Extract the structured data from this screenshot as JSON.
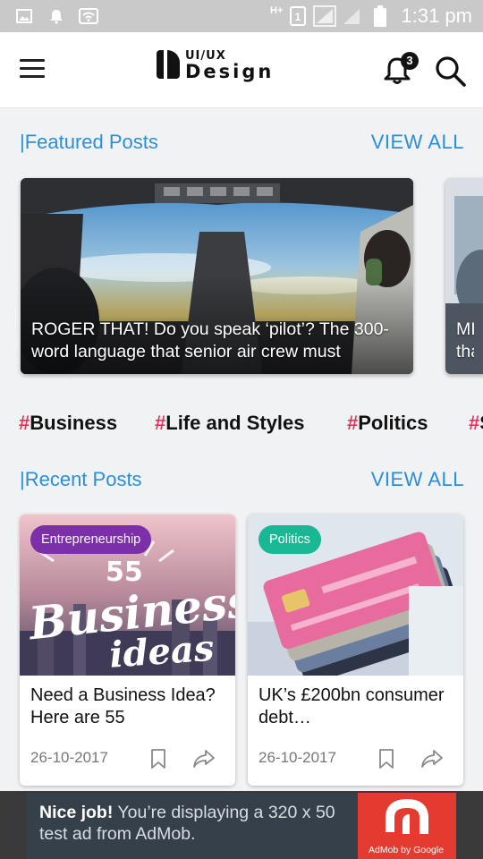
{
  "status_bar": {
    "time": "1:31 pm",
    "network": "H+"
  },
  "app_bar": {
    "logo_line1": "UI/UX",
    "logo_line2": "Design",
    "notification_count": "3"
  },
  "featured": {
    "title": "|Featured Posts",
    "view_all": "VIEW ALL",
    "cards": [
      {
        "caption": "ROGER THAT! Do you speak ‘pilot’? The 300-word language that senior air crew must"
      },
      {
        "caption": "MIL tha"
      }
    ]
  },
  "tags": [
    {
      "hash": "#",
      "label": "Business"
    },
    {
      "hash": "#",
      "label": "Life and Styles"
    },
    {
      "hash": "#",
      "label": "Politics"
    },
    {
      "hash": "#",
      "label": "S"
    }
  ],
  "recent": {
    "title": "|Recent Posts",
    "view_all": "VIEW ALL",
    "posts": [
      {
        "category": "Entrepreneurship",
        "category_color": "#7b2fa8",
        "image_text_top": "55",
        "image_text_main": "Business",
        "image_text_sub": "ideas",
        "title": "Need a Business Idea? Here are 55",
        "date": "26-10-2017"
      },
      {
        "category": "Politics",
        "category_color": "#19b894",
        "title": "UK’s £200bn consumer debt…",
        "date": "26-10-2017"
      }
    ]
  },
  "ad": {
    "headline": "Nice job!",
    "body": "You’re displaying a 320 x 50 test ad from AdMob.",
    "brand": "AdMob by Google"
  },
  "colors": {
    "accent": "#2b8fd6",
    "hashtag": "#e8305a",
    "ad_bg": "#35404b",
    "ad_logo": "#e33b2f"
  }
}
